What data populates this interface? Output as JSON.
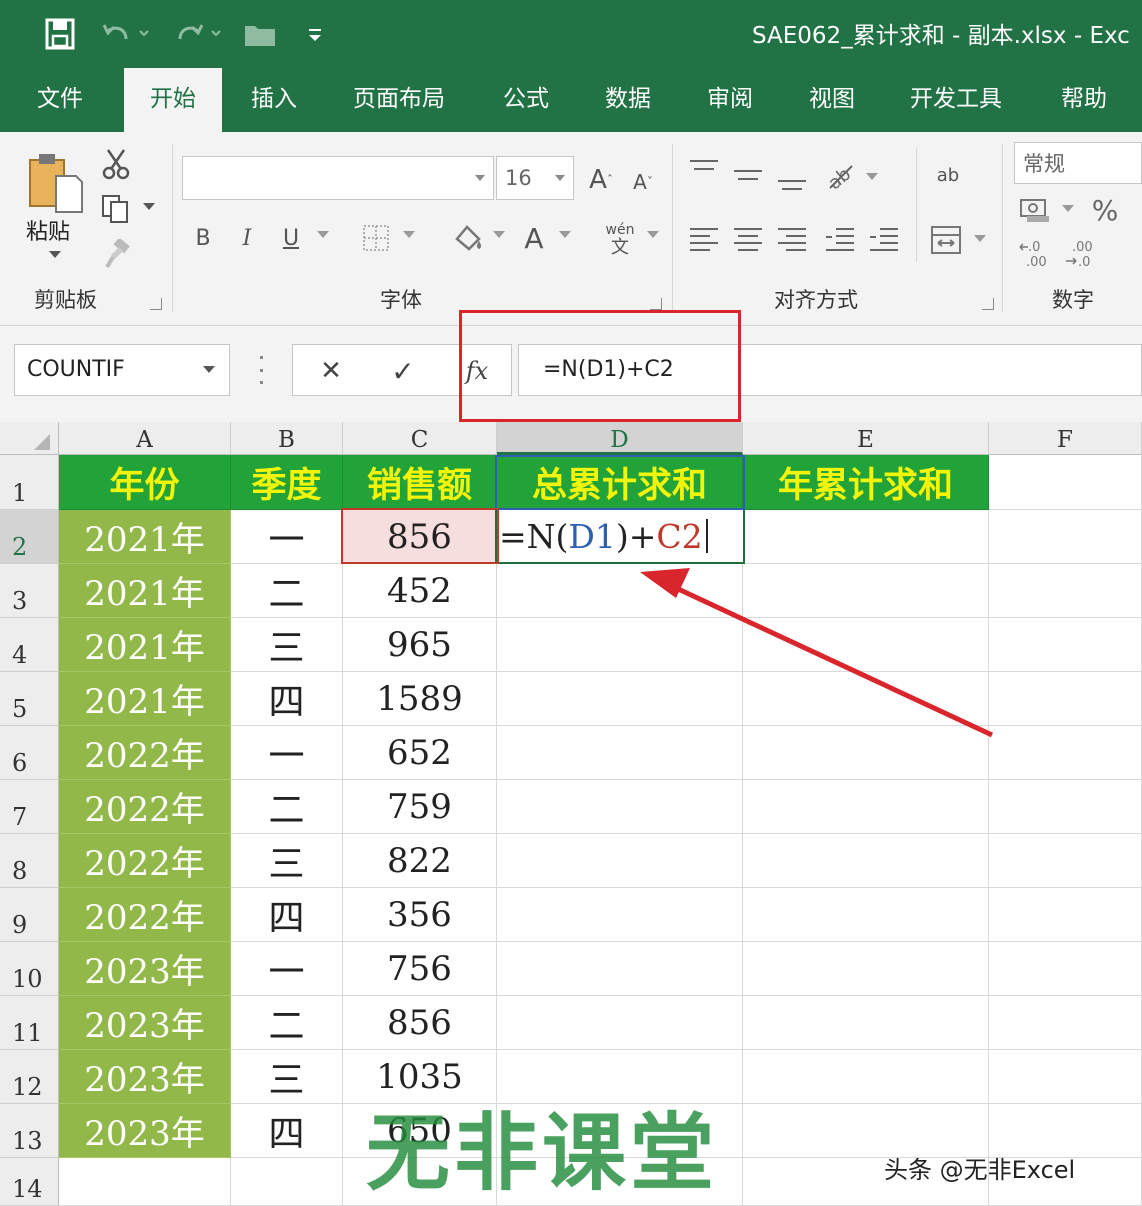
{
  "titlebar": {
    "doc_title": "SAE062_累计求和 - 副本.xlsx  -  Exc",
    "icons": [
      "save-icon",
      "undo-icon",
      "redo-icon",
      "open-folder-icon",
      "customize-qat-icon"
    ]
  },
  "tabs": [
    {
      "label": "文件",
      "active": false
    },
    {
      "label": "开始",
      "active": true
    },
    {
      "label": "插入",
      "active": false
    },
    {
      "label": "页面布局",
      "active": false
    },
    {
      "label": "公式",
      "active": false
    },
    {
      "label": "数据",
      "active": false
    },
    {
      "label": "审阅",
      "active": false
    },
    {
      "label": "视图",
      "active": false
    },
    {
      "label": "开发工具",
      "active": false
    },
    {
      "label": "帮助",
      "active": false
    }
  ],
  "ribbon": {
    "clipboard": {
      "paste_label": "粘贴",
      "group_label": "剪贴板"
    },
    "font": {
      "font_name": "",
      "font_size": "16",
      "bold": "B",
      "italic": "I",
      "underline": "U",
      "font_color_glyph": "A",
      "phonetic_top": "wén",
      "phonetic_bottom": "文",
      "group_label": "字体"
    },
    "alignment": {
      "wrap_text": "ab",
      "group_label": "对齐方式"
    },
    "number": {
      "format": "常规",
      "percent": "%",
      "group_label": "数字"
    }
  },
  "formula_bar": {
    "name_box": "COUNTIF",
    "cancel_glyph": "✕",
    "enter_glyph": "✓",
    "fx_glyph": "fx",
    "formula": "=N(D1)+C2"
  },
  "sheet": {
    "columns": [
      "A",
      "B",
      "C",
      "D",
      "E",
      "F"
    ],
    "selected_column": "D",
    "selected_row": "2",
    "rows": [
      "1",
      "2",
      "3",
      "4",
      "5",
      "6",
      "7",
      "8",
      "9",
      "10",
      "11",
      "12",
      "13",
      "14"
    ],
    "header": [
      "年份",
      "季度",
      "销售额",
      "总累计求和",
      "年累计求和"
    ],
    "data": [
      {
        "year": "2021年",
        "quarter": "一",
        "sales": "856"
      },
      {
        "year": "2021年",
        "quarter": "二",
        "sales": "452"
      },
      {
        "year": "2021年",
        "quarter": "三",
        "sales": "965"
      },
      {
        "year": "2021年",
        "quarter": "四",
        "sales": "1589"
      },
      {
        "year": "2022年",
        "quarter": "一",
        "sales": "652"
      },
      {
        "year": "2022年",
        "quarter": "二",
        "sales": "759"
      },
      {
        "year": "2022年",
        "quarter": "三",
        "sales": "822"
      },
      {
        "year": "2022年",
        "quarter": "四",
        "sales": "356"
      },
      {
        "year": "2023年",
        "quarter": "一",
        "sales": "756"
      },
      {
        "year": "2023年",
        "quarter": "二",
        "sales": "856"
      },
      {
        "year": "2023年",
        "quarter": "三",
        "sales": "1035"
      },
      {
        "year": "2023年",
        "quarter": "四",
        "sales": "650"
      }
    ],
    "editing_cell": {
      "ref": "D2",
      "text_eq": "=N",
      "text_paren_open": "(",
      "text_ref": "D1",
      "text_paren_close": ")",
      "text_plus": "+",
      "text_c2": "C2"
    }
  },
  "overlay": {
    "watermark": "无非课堂",
    "credit": "头条 @无非Excel"
  },
  "colors": {
    "excel_green": "#217346",
    "header_fill": "#22a33a",
    "header_text": "#f2f50a",
    "year_fill": "#92b84a",
    "highlight_red": "#d9262c",
    "ref_d1_blue": "#2f5fb3",
    "ref_c2_red": "#c0392b"
  }
}
